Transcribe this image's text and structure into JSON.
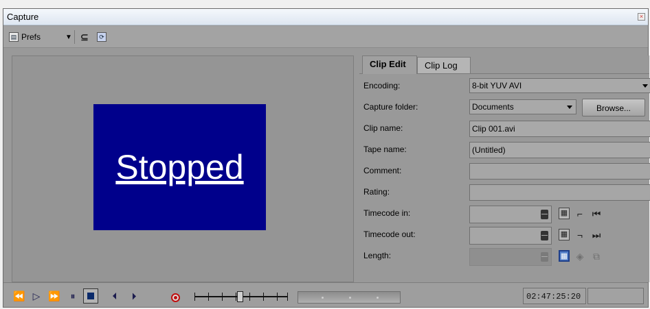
{
  "window": {
    "title": "Capture",
    "close_icon": "close-icon"
  },
  "toolbar": {
    "prefs_label": "Prefs",
    "prefs_icon": "prefs-icon",
    "icons": [
      "dropdown-arrow-icon",
      "capture-time-icon",
      "refresh-icon"
    ]
  },
  "preview": {
    "status_text": "Stopped",
    "status_bg": "#00008b"
  },
  "tabs": [
    {
      "label": "Clip Edit",
      "active": true
    },
    {
      "label": "Clip Log",
      "active": false
    }
  ],
  "form": {
    "encoding": {
      "label": "Encoding:",
      "value": "8-bit YUV AVI"
    },
    "capture_folder": {
      "label": "Capture folder:",
      "value": "Documents",
      "browse_label": "Browse..."
    },
    "clip_name": {
      "label": "Clip name:",
      "value": "Clip 001.avi"
    },
    "tape_name": {
      "label": "Tape name:",
      "value": "(Untitled)"
    },
    "comment": {
      "label": "Comment:",
      "value": ""
    },
    "rating": {
      "label": "Rating:",
      "value": ""
    },
    "timecode_in": {
      "label": "Timecode in:",
      "value": ""
    },
    "timecode_out": {
      "label": "Timecode out:",
      "value": ""
    },
    "length": {
      "label": "Length:",
      "value": ""
    }
  },
  "transport": {
    "timecode": "02:47:25:20",
    "timecode2": "",
    "slider_level": 0.5
  }
}
